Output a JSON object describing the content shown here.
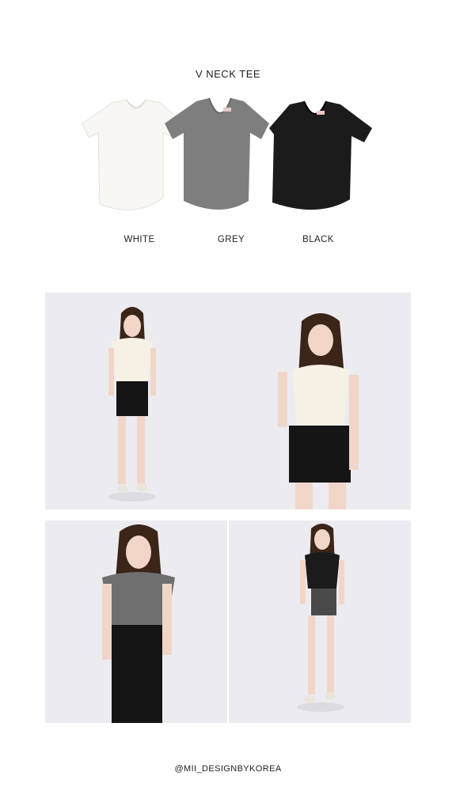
{
  "title": "V NECK TEE",
  "colors": [
    {
      "label": "WHITE",
      "hex": "#f7f6f2"
    },
    {
      "label": "GREY",
      "hex": "#7d7d7d"
    },
    {
      "label": "BLACK",
      "hex": "#1b1b1b"
    }
  ],
  "photo_bg": "#ecebf0",
  "footer": {
    "handle": "@MII_DESIGNBYKOREA"
  }
}
